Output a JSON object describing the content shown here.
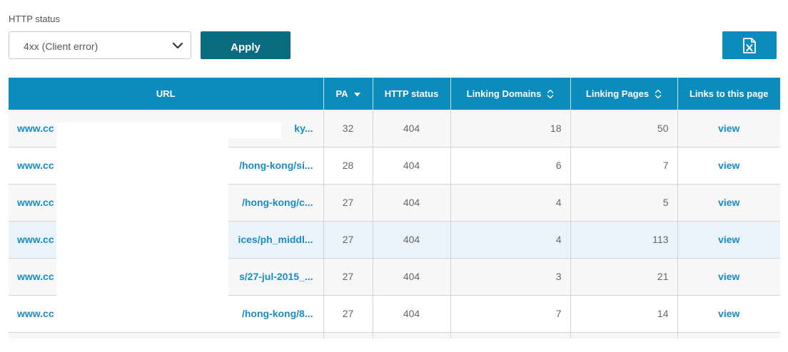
{
  "filter": {
    "label": "HTTP status",
    "selected": "4xx (Client error)",
    "apply_label": "Apply"
  },
  "table": {
    "headers": [
      "URL",
      "PA",
      "HTTP status",
      "Linking Domains",
      "Linking Pages",
      "Links to this page"
    ],
    "rows": [
      {
        "url_left": "www.cc",
        "url_right": "ky...",
        "pa": "32",
        "status": "404",
        "domains": "18",
        "pages": "50",
        "link": "view"
      },
      {
        "url_left": "www.cc",
        "url_right": "/hong-kong/si...",
        "pa": "28",
        "status": "404",
        "domains": "6",
        "pages": "7",
        "link": "view"
      },
      {
        "url_left": "www.cc",
        "url_right": "/hong-kong/c...",
        "pa": "27",
        "status": "404",
        "domains": "4",
        "pages": "5",
        "link": "view"
      },
      {
        "url_left": "www.cc",
        "url_right": "ices/ph_middl...",
        "pa": "27",
        "status": "404",
        "domains": "4",
        "pages": "113",
        "link": "view"
      },
      {
        "url_left": "www.cc",
        "url_right": "s/27-jul-2015_...",
        "pa": "27",
        "status": "404",
        "domains": "3",
        "pages": "21",
        "link": "view"
      },
      {
        "url_left": "www.cc",
        "url_right": "/hong-kong/8...",
        "pa": "27",
        "status": "404",
        "domains": "7",
        "pages": "14",
        "link": "view"
      }
    ]
  },
  "colors": {
    "header_bg": "#0c8bbd",
    "apply_bg": "#0b6b80",
    "link": "#1a8cc4",
    "highlight_row": "#e9f3f9"
  },
  "icons": {
    "select": "chevron-down-icon",
    "export": "excel-file-icon",
    "pa_sort": "sort-descending-icon",
    "column_sort": "sort-both-icon"
  }
}
